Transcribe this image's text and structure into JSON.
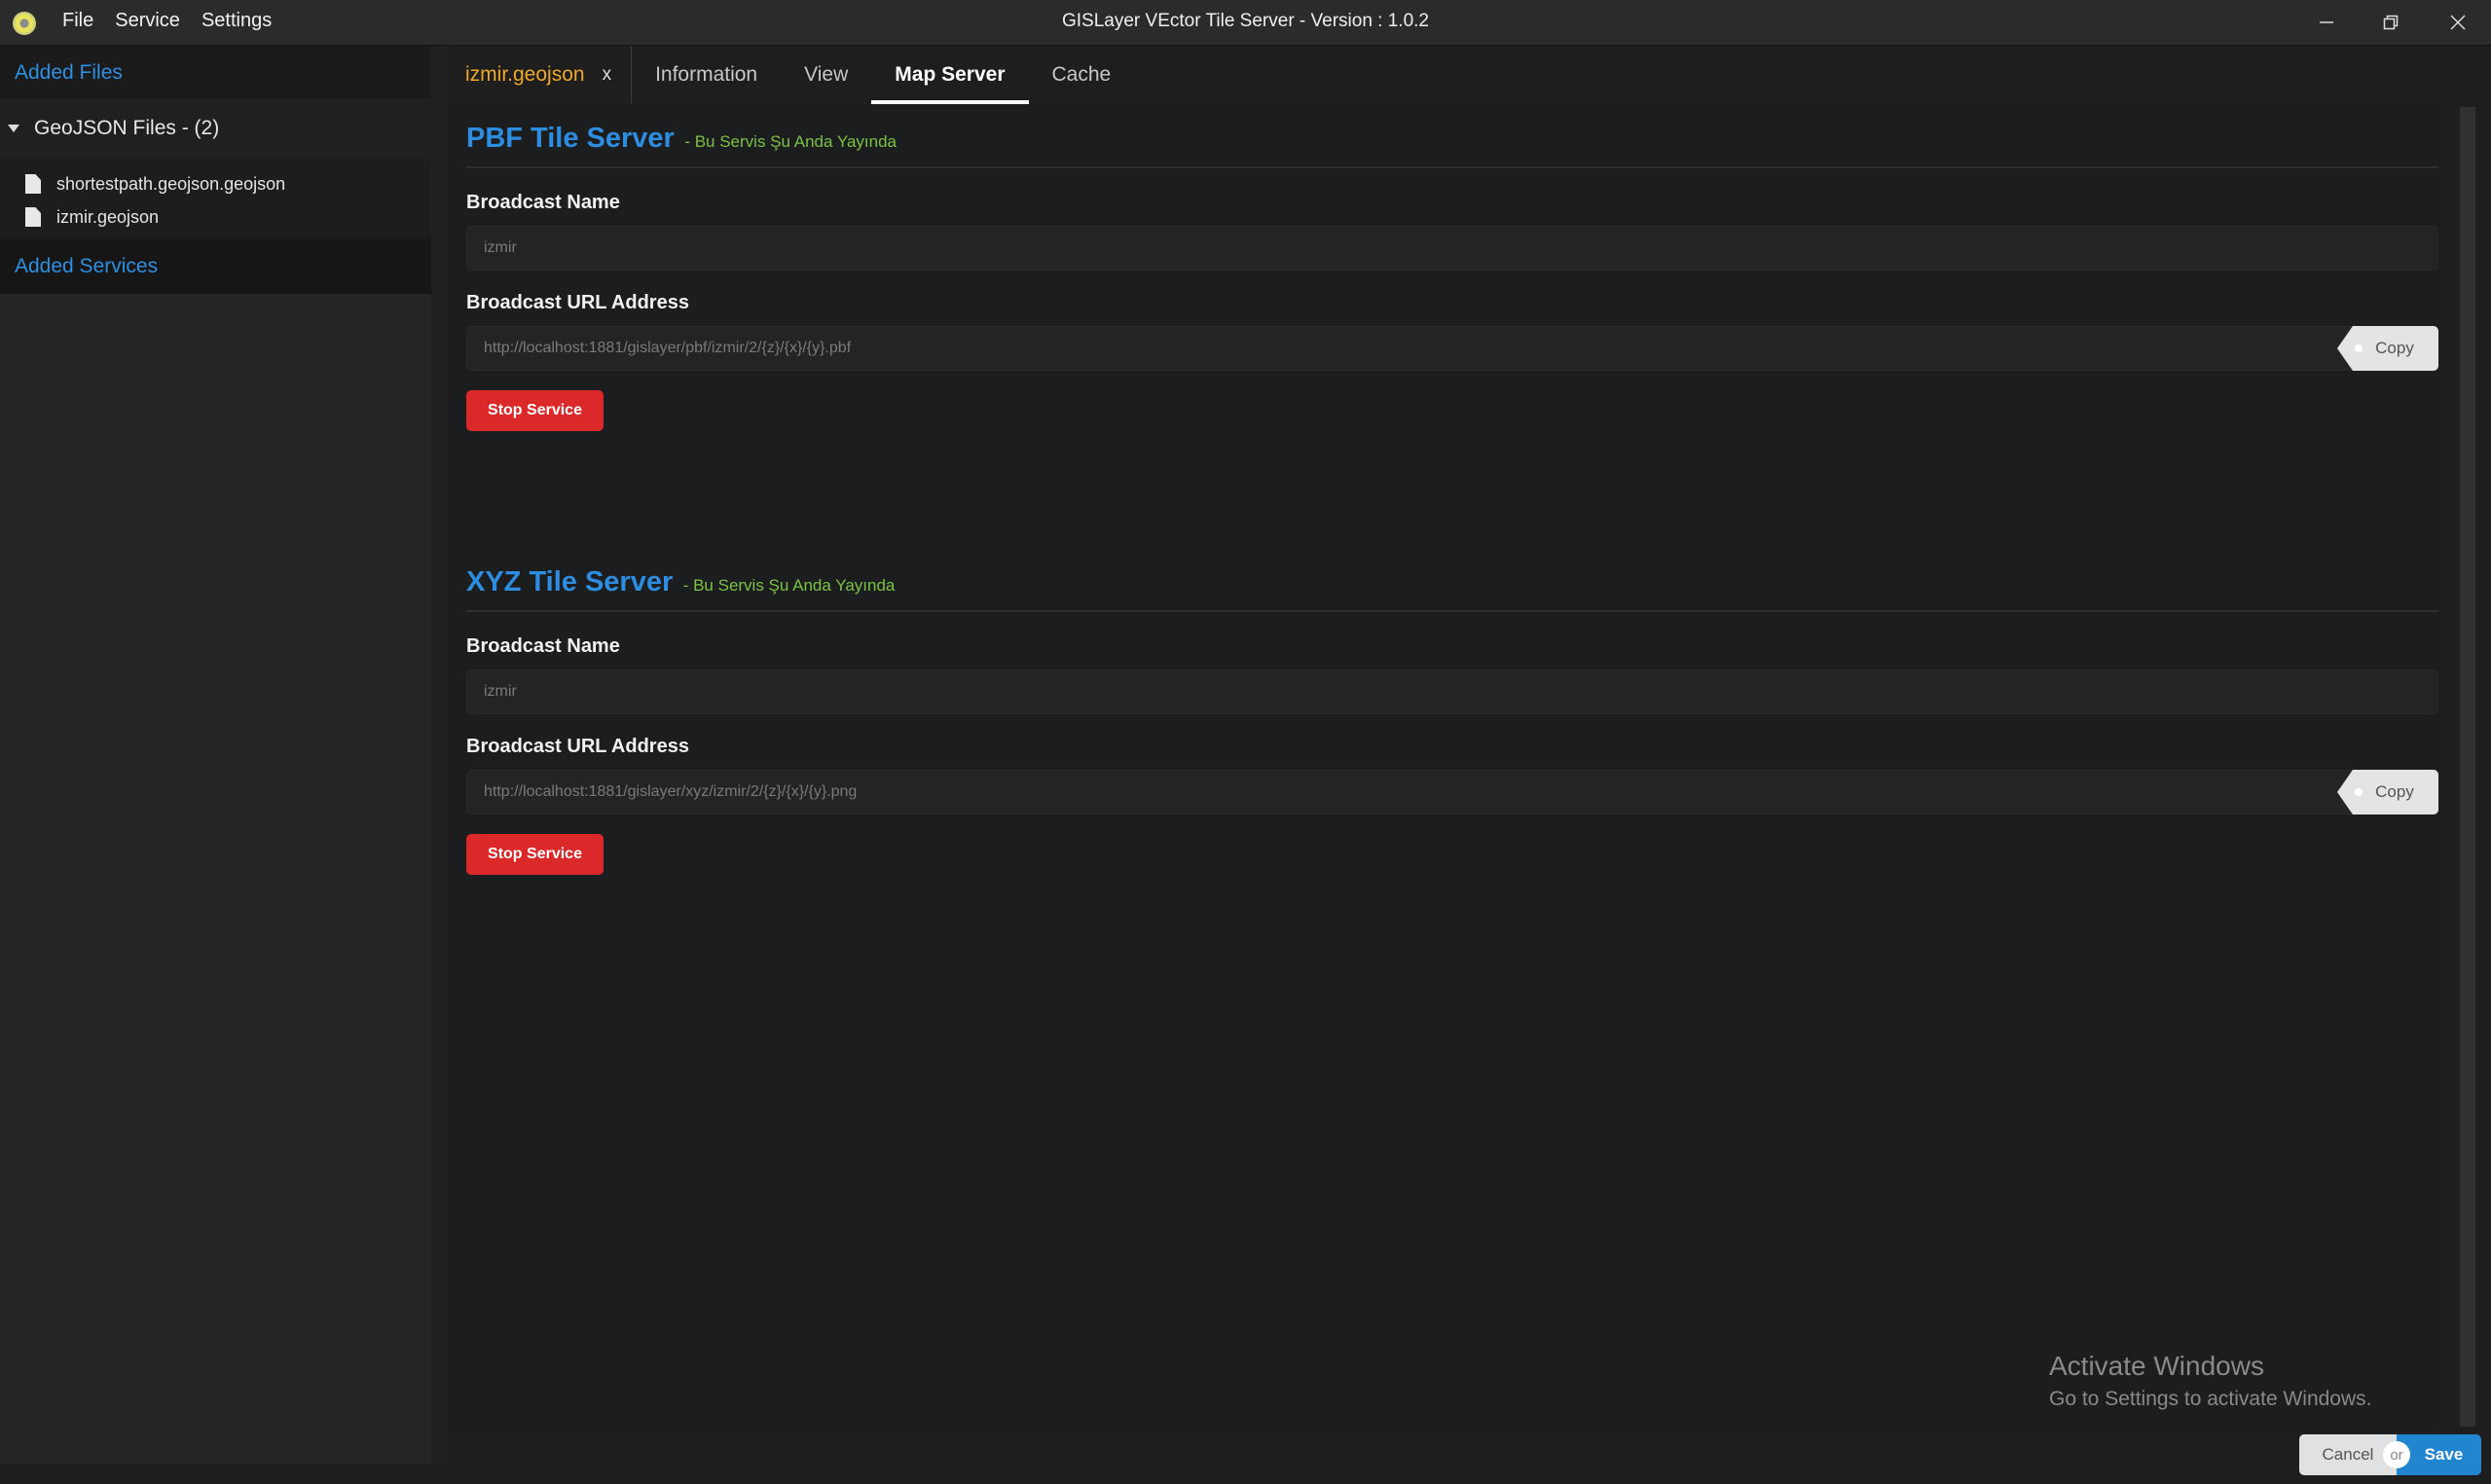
{
  "app": {
    "title": "GISLayer VEctor Tile Server - Version : 1.0.2",
    "menu": [
      "File",
      "Service",
      "Settings"
    ]
  },
  "window_controls": {
    "minimize": "minimize-icon",
    "restore": "restore-icon",
    "close": "close-icon"
  },
  "sidebar": {
    "added_files_label": "Added Files",
    "group_label": "GeoJSON Files - (2)",
    "files": [
      "shortestpath.geojson.geojson",
      "izmir.geojson"
    ],
    "added_services_label": "Added Services"
  },
  "tabs": {
    "file_tab": "izmir.geojson",
    "file_tab_close": "x",
    "items": [
      "Information",
      "View",
      "Map Server",
      "Cache"
    ],
    "active": "Map Server"
  },
  "sections": [
    {
      "title": "PBF Tile Server",
      "status": "- Bu Servis Şu Anda Yayında",
      "name_label": "Broadcast Name",
      "name_value": "izmir",
      "url_label": "Broadcast URL Address",
      "url_value": "http://localhost:1881/gislayer/pbf/izmir/2/{z}/{x}/{y}.pbf",
      "copy_label": "Copy",
      "stop_label": "Stop Service"
    },
    {
      "title": "XYZ Tile Server",
      "status": "- Bu Servis Şu Anda Yayında",
      "name_label": "Broadcast Name",
      "name_value": "izmir",
      "url_label": "Broadcast URL Address",
      "url_value": "http://localhost:1881/gislayer/xyz/izmir/2/{z}/{x}/{y}.png",
      "copy_label": "Copy",
      "stop_label": "Stop Service"
    }
  ],
  "watermark": {
    "line1": "Activate Windows",
    "line2": "Go to Settings to activate Windows."
  },
  "actions": {
    "cancel": "Cancel",
    "or": "or",
    "save": "Save"
  },
  "colors": {
    "accent": "#2d8de0",
    "status": "#7cc242",
    "danger": "#db2828",
    "file_tab": "#f0a82a",
    "save": "#2185d0"
  }
}
